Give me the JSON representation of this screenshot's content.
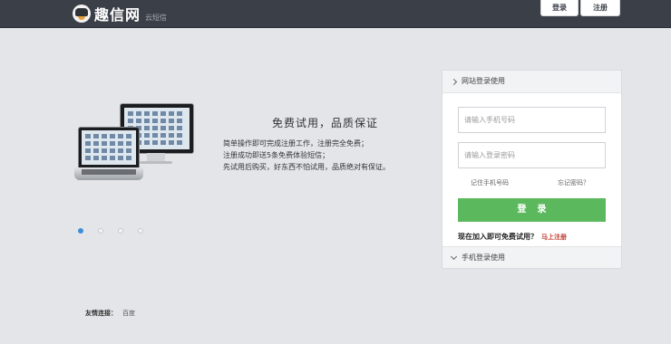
{
  "header": {
    "logo_name": "趣信网",
    "logo_sub": "云短信",
    "nav": [
      {
        "label": "登录"
      },
      {
        "label": "注册"
      }
    ]
  },
  "promo": {
    "headline": "免费试用，品质保证",
    "lines": [
      "简单操作即可完成注册工作，注册完全免费；",
      "注册成功即送5条免费体验短信；",
      "先试用后购买，好东西不怕试用，品质绝对有保证。"
    ],
    "carousel_dots": 4,
    "active_dot": 0
  },
  "login_panel": {
    "header": "网站登录使用",
    "phone_placeholder": "请输入手机号码",
    "password_placeholder": "请输入登录密码",
    "remember_label": "记住手机号码",
    "forgot_label": "忘记密码？",
    "login_button": "登录",
    "join_text": "现在加入即可免费试用？",
    "register_link": "马上注册",
    "footer": "手机登录使用"
  },
  "footer": {
    "friends_label": "友情连接：",
    "friends": [
      "百度"
    ]
  },
  "colors": {
    "topbar": "#3b4048",
    "background": "#e3e5e8",
    "login_button": "#5cb85c",
    "register_link": "#c0392b",
    "active_dot": "#3d8ed8"
  }
}
